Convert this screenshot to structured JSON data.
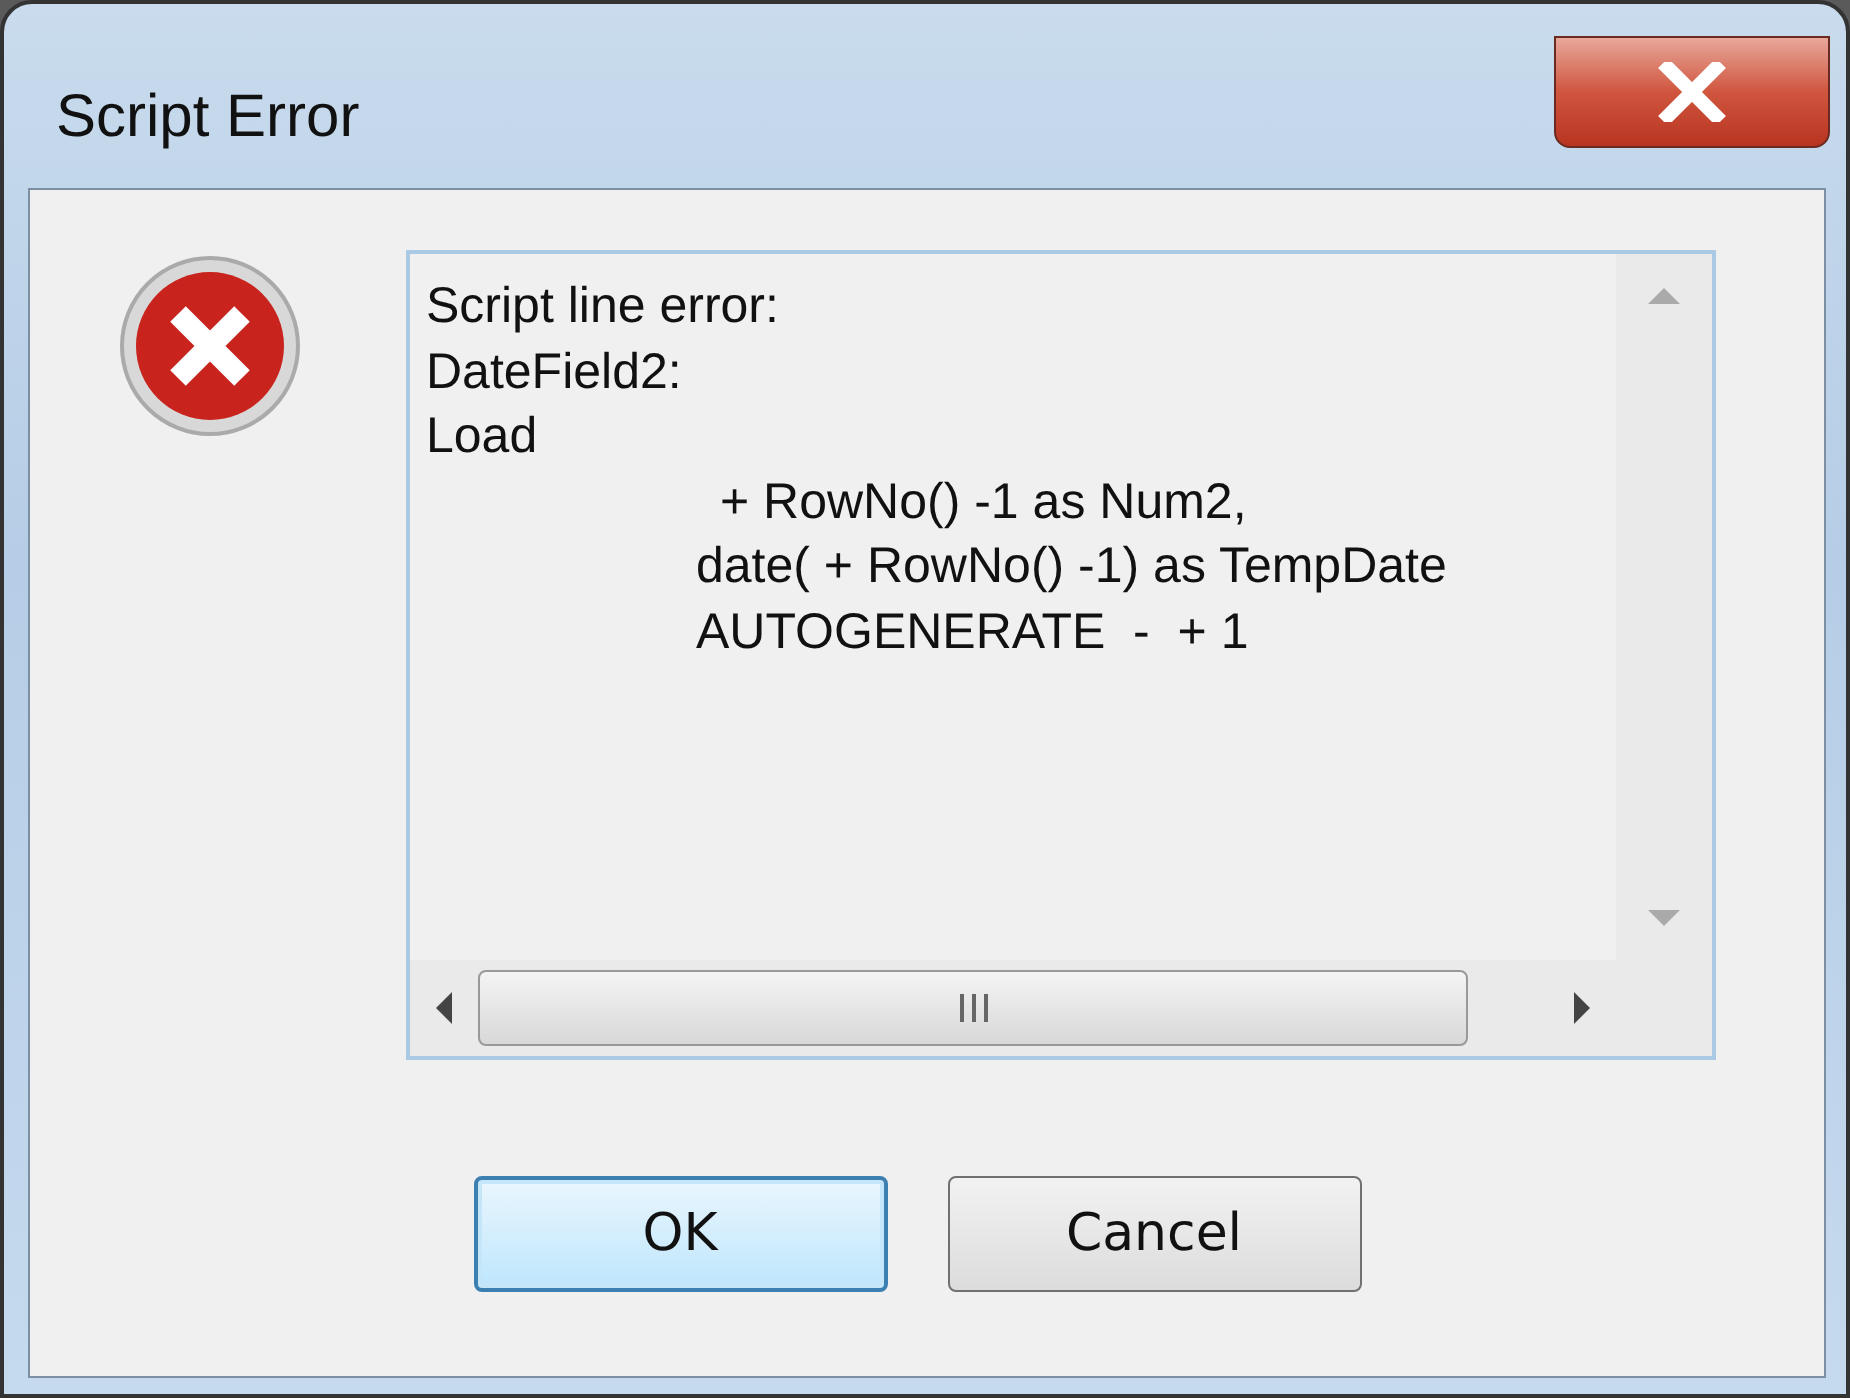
{
  "window": {
    "title": "Script Error"
  },
  "message_lines": [
    {
      "text": "Script line error:",
      "kind": "plain"
    },
    {
      "text": "DateField2:",
      "kind": "plain"
    },
    {
      "text": "Load",
      "kind": "plain"
    },
    {
      "text": "+ RowNo() -1 as Num2,",
      "kind": "indented-extra"
    },
    {
      "text": "date( + RowNo() -1) as TempDate",
      "kind": "indented"
    },
    {
      "text": "AUTOGENERATE  -  + 1",
      "kind": "indented"
    }
  ],
  "buttons": [
    {
      "label": "OK",
      "default": true
    },
    {
      "label": "Cancel",
      "default": false
    }
  ]
}
